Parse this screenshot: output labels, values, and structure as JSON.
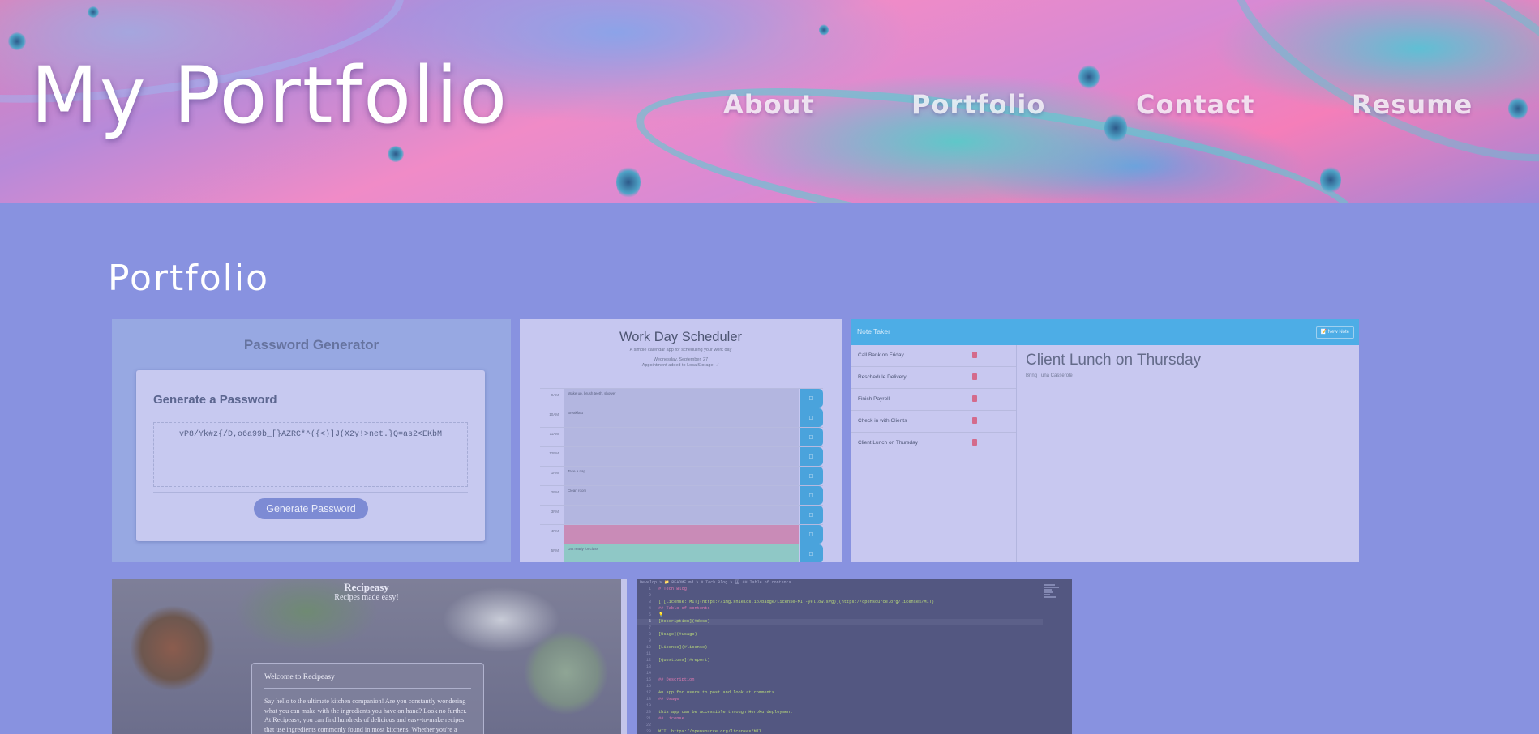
{
  "header": {
    "site_title": "My Portfolio",
    "nav": [
      {
        "label": "About"
      },
      {
        "label": "Portfolio"
      },
      {
        "label": "Contact"
      },
      {
        "label": "Resume"
      }
    ]
  },
  "portfolio": {
    "heading": "Portfolio",
    "password_generator": {
      "heading": "Password Generator",
      "card_title": "Generate a Password",
      "password": "vP8/Yk#z{/D,o6a99b_[}AZRC*^({<)]J(X2y!>net.}Q=as2<EKbM",
      "button": "Generate Password"
    },
    "scheduler": {
      "title": "Work Day Scheduler",
      "subtitle": "A simple calendar app for scheduling your work day",
      "date": "Wednesday, September, 27",
      "status": "Appointment added to LocalStorage! ✓",
      "save_icon": "save-icon",
      "rows": [
        {
          "hour": "9AM",
          "event": "Wake up, brush teeth, shower"
        },
        {
          "hour": "10AM",
          "event": "Breakfast"
        },
        {
          "hour": "11AM",
          "event": ""
        },
        {
          "hour": "12PM",
          "event": ""
        },
        {
          "hour": "1PM",
          "event": "Take a nap"
        },
        {
          "hour": "2PM",
          "event": "Clean room"
        },
        {
          "hour": "3PM",
          "event": ""
        },
        {
          "hour": "4PM",
          "event": ""
        },
        {
          "hour": "5PM",
          "event": "Get ready for class"
        }
      ],
      "colors": {
        "past": "#b3b6e0",
        "present": "#c98bb7",
        "future": "#8fc8c6"
      }
    },
    "note_taker": {
      "brand": "Note Taker",
      "new_note": "📝 New Note",
      "notes": [
        {
          "title": "Call Bank on Friday"
        },
        {
          "title": "Reschedule Delivery"
        },
        {
          "title": "Finish Payroll"
        },
        {
          "title": "Check in with Clients"
        },
        {
          "title": "Client Lunch on Thursday"
        }
      ],
      "active_note": {
        "title": "Client Lunch on Thursday",
        "text": "Bring Tuna Casserole"
      }
    },
    "recipeasy": {
      "brand": "Recipeasy",
      "tagline": "Recipes made easy!",
      "panel_title": "Welcome to Recipeasy",
      "panel_body": "Say hello to the ultimate kitchen companion! Are you constantly wondering what you can make with the ingredients you have on hand? Look no further. At Recipeasy, you can find hundreds of delicious and easy-to-make recipes that use ingredients commonly found in most kitchens. Whether you're a seasoned cook or just starting out, this easy"
    },
    "tech_blog": {
      "breadcrumb": "Develop > 📁 README.md > # Tech Blog > 🗄 ## Table of contents",
      "lines": [
        {
          "n": "1",
          "text": "# Tech Blog"
        },
        {
          "n": "2",
          "text": ""
        },
        {
          "n": "3",
          "text": "[![License: MIT](https://img.shields.io/badge/License-MIT-yellow.svg)](https://opensource.org/licenses/MIT)"
        },
        {
          "n": "4",
          "text": "## Table of contents"
        },
        {
          "n": "5",
          "text": "💡"
        },
        {
          "n": "6",
          "text": "[Description](#desc)"
        },
        {
          "n": "7",
          "text": ""
        },
        {
          "n": "8",
          "text": "[Usage](#usage)"
        },
        {
          "n": "9",
          "text": ""
        },
        {
          "n": "10",
          "text": "[License](#license)"
        },
        {
          "n": "11",
          "text": ""
        },
        {
          "n": "12",
          "text": "[Questions](#report)"
        },
        {
          "n": "13",
          "text": ""
        },
        {
          "n": "14",
          "text": ""
        },
        {
          "n": "15",
          "text": "## Description"
        },
        {
          "n": "16",
          "text": ""
        },
        {
          "n": "17",
          "text": "    An app for users to post and look at comments"
        },
        {
          "n": "18",
          "text": "## Usage"
        },
        {
          "n": "19",
          "text": ""
        },
        {
          "n": "20",
          "text": "    this app can be accessible through Heroku deployment"
        },
        {
          "n": "21",
          "text": "## License"
        },
        {
          "n": "22",
          "text": ""
        },
        {
          "n": "23",
          "text": "    MIT, https://opensource.org/licenses/MIT"
        }
      ],
      "active_line": 6
    }
  }
}
